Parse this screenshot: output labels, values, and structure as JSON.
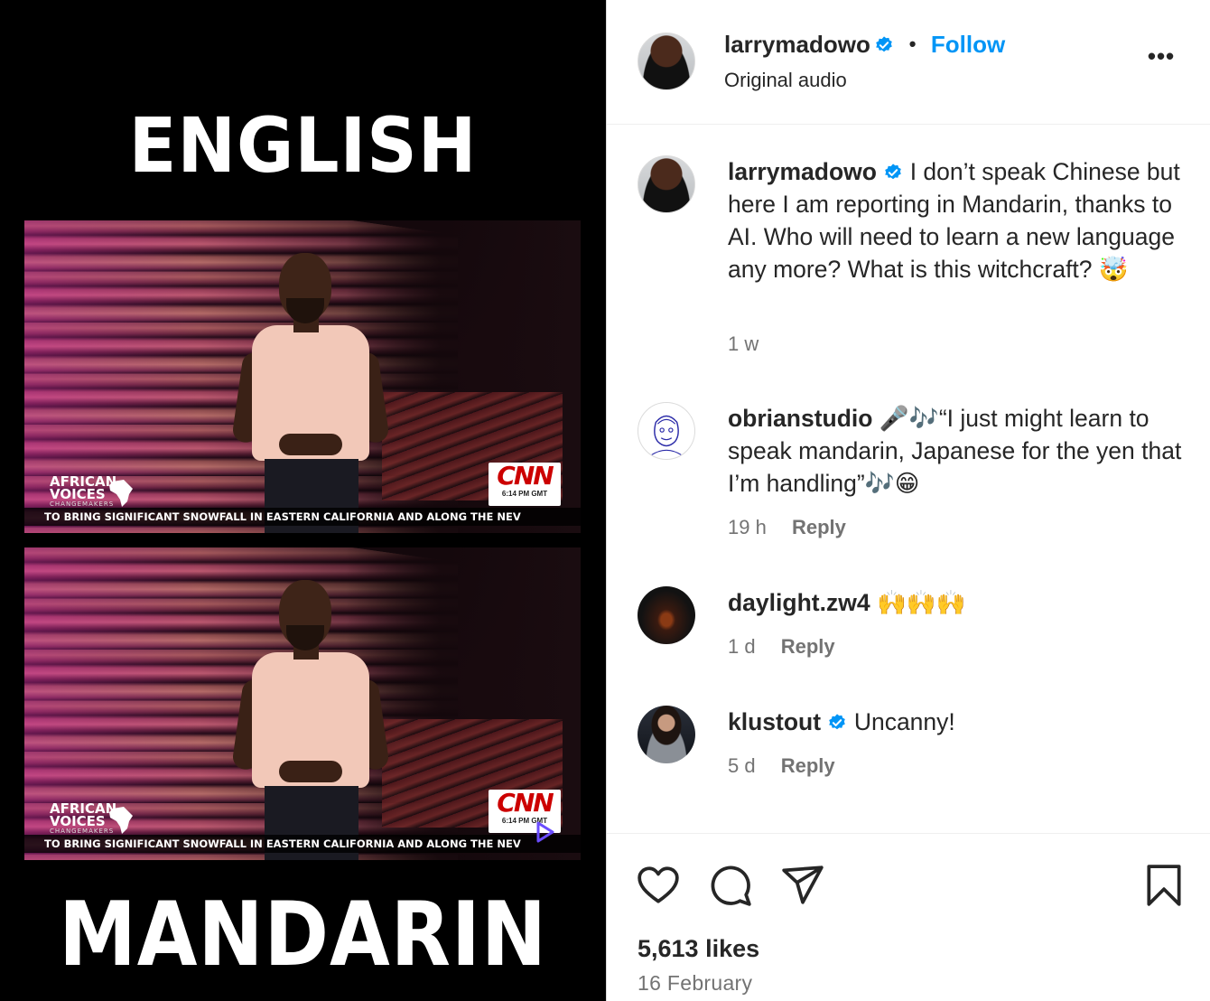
{
  "media": {
    "top_label": "ENGLISH",
    "bottom_label": "MANDARIN",
    "frames": [
      {
        "brand_line1": "AFRICAN",
        "brand_line2": "VOICES",
        "brand_line3": "CHANGEMAKERS",
        "network": "CNN",
        "time": "6:14 PM GMT",
        "ticker": "TO BRING SIGNIFICANT SNOWFALL IN EASTERN CALIFORNIA AND ALONG THE NEV"
      },
      {
        "brand_line1": "AFRICAN",
        "brand_line2": "VOICES",
        "brand_line3": "CHANGEMAKERS",
        "network": "CNN",
        "time": "6:14 PM GMT",
        "ticker": "TO BRING SIGNIFICANT SNOWFALL IN EASTERN CALIFORNIA AND ALONG THE NEV"
      }
    ]
  },
  "header": {
    "username": "larrymadowo",
    "separator": "•",
    "follow_label": "Follow",
    "audio_label": "Original audio",
    "more_label": "•••"
  },
  "comments": [
    {
      "username": "larrymadowo",
      "verified": true,
      "text": "I don’t speak Chinese but here I am reporting in Mandarin, thanks to AI. Who will need to learn a new language any more? What is this witchcraft? 🤯",
      "time": "1 w",
      "reply_label": ""
    },
    {
      "username": "obrianstudio",
      "verified": false,
      "text": "🎤🎶“I just might learn to speak mandarin, Japanese for the yen that I’m handling”🎶😁",
      "time": "19 h",
      "reply_label": "Reply"
    },
    {
      "username": "daylight.zw4",
      "verified": false,
      "text": "🙌🙌🙌",
      "time": "1 d",
      "reply_label": "Reply"
    },
    {
      "username": "klustout",
      "verified": true,
      "text": "Uncanny!",
      "time": "5 d",
      "reply_label": "Reply"
    }
  ],
  "footer": {
    "likes": "5,613 likes",
    "date": "16 February"
  },
  "icons": {
    "like": "heart-icon",
    "comment": "comment-icon",
    "share": "share-icon",
    "save": "bookmark-icon",
    "verified": "verified-badge-icon",
    "more": "more-options-icon"
  },
  "colors": {
    "follow": "#0095f6",
    "verified": "#0095f6",
    "muted": "#737373",
    "text": "#262626",
    "cnn_red": "#cc0000"
  }
}
